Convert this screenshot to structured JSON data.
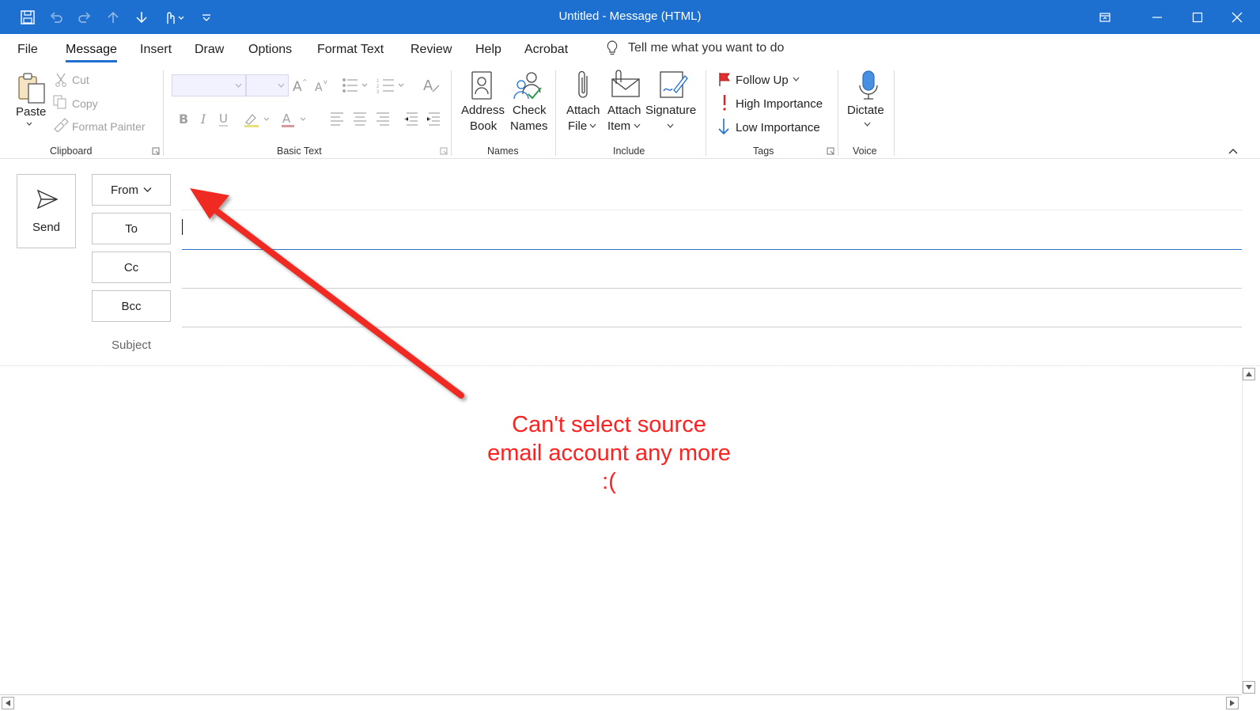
{
  "window": {
    "title": "Untitled  -  Message (HTML)"
  },
  "menu": {
    "tabs": [
      "File",
      "Message",
      "Insert",
      "Draw",
      "Options",
      "Format Text",
      "Review",
      "Help",
      "Acrobat"
    ],
    "active_tab": "Message",
    "tell_me": "Tell me what you want to do"
  },
  "ribbon": {
    "clipboard": {
      "label": "Clipboard",
      "paste": "Paste",
      "cut": "Cut",
      "copy": "Copy",
      "format_painter": "Format Painter"
    },
    "basic_text": {
      "label": "Basic Text"
    },
    "names": {
      "label": "Names",
      "address_book_1": "Address",
      "address_book_2": "Book",
      "check_names_1": "Check",
      "check_names_2": "Names"
    },
    "include": {
      "label": "Include",
      "attach_file_1": "Attach",
      "attach_file_2": "File",
      "attach_item_1": "Attach",
      "attach_item_2": "Item",
      "signature": "Signature"
    },
    "tags": {
      "label": "Tags",
      "follow_up": "Follow Up",
      "high_importance": "High Importance",
      "low_importance": "Low Importance"
    },
    "voice": {
      "label": "Voice",
      "dictate": "Dictate"
    }
  },
  "compose": {
    "send": "Send",
    "from": "From",
    "to": "To",
    "cc": "Cc",
    "bcc": "Bcc",
    "subject": "Subject"
  },
  "annotation": {
    "line1": "Can't select source",
    "line2": "email account any more",
    "line3": ":("
  },
  "colors": {
    "titlebar": "#1d6fd0",
    "accent": "#1d6fd0",
    "annotation": "#ff2020"
  }
}
